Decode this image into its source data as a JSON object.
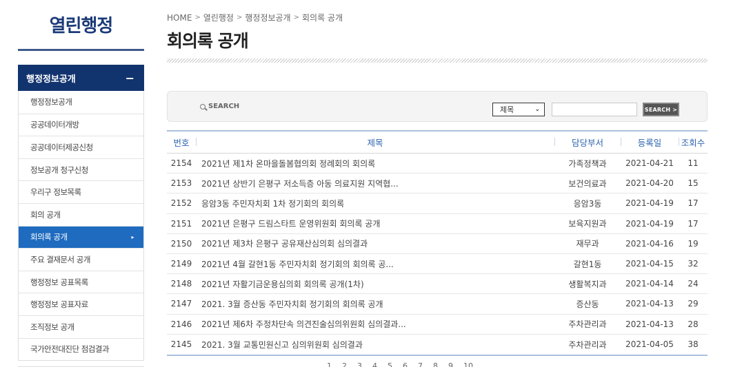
{
  "sidebar": {
    "title": "열린행정",
    "section": "행정정보공개",
    "section_toggle": "−",
    "items": [
      {
        "label": "행정정보공개"
      },
      {
        "label": "공공데이터개방"
      },
      {
        "label": "공공데이터제공신청"
      },
      {
        "label": "정보공개 청구신청"
      },
      {
        "label": "우리구 정보목록"
      },
      {
        "label": "회의 공개"
      },
      {
        "label": "회의록 공개"
      },
      {
        "label": "주요 결재문서 공개"
      },
      {
        "label": "행정정보 공표목록"
      },
      {
        "label": "행정정보 공표자료"
      },
      {
        "label": "조직정보 공개"
      },
      {
        "label": "국가안전대진단 점검결과"
      }
    ],
    "active_index": 6
  },
  "breadcrumb": [
    "HOME",
    "열린행정",
    "행정정보공개",
    "회의록 공개"
  ],
  "page_title": "회의록 공개",
  "search": {
    "label": "SEARCH",
    "field_selected": "제목",
    "input_value": "",
    "button_label": "SEARCH >"
  },
  "table": {
    "headers": {
      "num": "번호",
      "title": "제목",
      "dept": "담당부서",
      "date": "등록일",
      "views": "조회수"
    },
    "rows": [
      {
        "num": "2154",
        "title": "2021년 제1차 온마을돌봄협의회 정례회의 회의록",
        "dept": "가족정책과",
        "date": "2021-04-21",
        "views": "11"
      },
      {
        "num": "2153",
        "title": "2021년 상반기 은평구 저소득층 아동 의료지원 지역협...",
        "dept": "보건의료과",
        "date": "2021-04-20",
        "views": "15"
      },
      {
        "num": "2152",
        "title": "응암3동 주민자치회 1차 정기회의 회의록",
        "dept": "응암3동",
        "date": "2021-04-19",
        "views": "17"
      },
      {
        "num": "2151",
        "title": "2021년 은평구 드림스타트 운영위원회 회의록 공개",
        "dept": "보육지원과",
        "date": "2021-04-19",
        "views": "17"
      },
      {
        "num": "2150",
        "title": "2021년 제3차 은평구 공유재산심의회 심의결과",
        "dept": "재무과",
        "date": "2021-04-16",
        "views": "19"
      },
      {
        "num": "2149",
        "title": "2021년 4월 갈현1동 주민자치회 정기회의 회의록 공...",
        "dept": "갈현1동",
        "date": "2021-04-15",
        "views": "32"
      },
      {
        "num": "2148",
        "title": "2021년 자활기금운용심의회 회의록 공개(1차)",
        "dept": "생활복지과",
        "date": "2021-04-14",
        "views": "24"
      },
      {
        "num": "2147",
        "title": "2021. 3월 증산동 주민자치회 정기회의 회의록 공개",
        "dept": "증산동",
        "date": "2021-04-13",
        "views": "29"
      },
      {
        "num": "2146",
        "title": "2021년 제6차 주정차단속 의견진술심의위원회 심의결과...",
        "dept": "주차관리과",
        "date": "2021-04-13",
        "views": "28"
      },
      {
        "num": "2145",
        "title": "2021. 3월 교통민원신고 심의위원회 심의결과",
        "dept": "주차관리과",
        "date": "2021-04-05",
        "views": "38"
      }
    ]
  },
  "pagination": [
    "1",
    "2",
    "3",
    "4",
    "5",
    "6",
    "7",
    "8",
    "9",
    "10"
  ]
}
